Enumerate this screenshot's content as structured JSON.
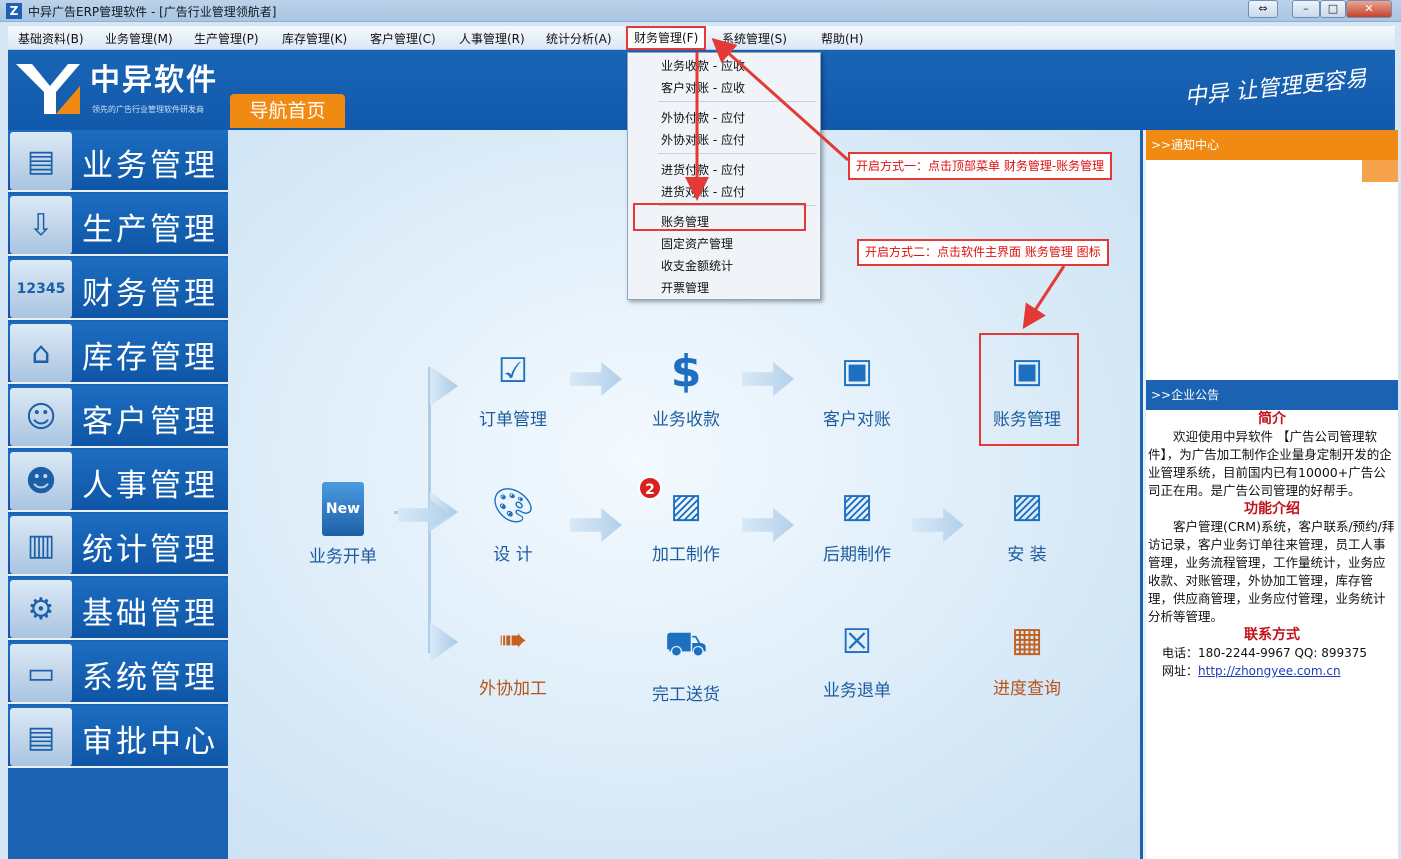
{
  "window": {
    "title": "中异广告ERP管理软件 - [广告行业管理领航者]",
    "controls": {
      "restore_alt": "⇔",
      "minimize": "–",
      "maximize": "□",
      "close": "✕"
    }
  },
  "menubar": [
    "基础资料(B)",
    "业务管理(M)",
    "生产管理(P)",
    "库存管理(K)",
    "客户管理(C)",
    "人事管理(R)",
    "统计分析(A)",
    "财务管理(F)",
    "系统管理(S)",
    "帮助(H)"
  ],
  "banner": {
    "brand": "中异软件",
    "tagline": "领先的广告行业管理软件研发商",
    "nav_tab": "导航首页",
    "slogan": "中异 让管理更容易"
  },
  "dropdown": {
    "items": [
      "业务收款 - 应收",
      "客户对账 - 应收",
      "外协付款 - 应付",
      "外协对账 - 应付",
      "进货付款 - 应付",
      "进货对账 - 应付",
      "账务管理",
      "固定资产管理",
      "收支金额统计",
      "开票管理"
    ]
  },
  "sidebar": [
    {
      "label": "业务管理",
      "icon": "document-icon"
    },
    {
      "label": "生产管理",
      "icon": "download-doc-icon"
    },
    {
      "label": "财务管理",
      "icon": "calculator-icon"
    },
    {
      "label": "库存管理",
      "icon": "warehouse-icon"
    },
    {
      "label": "客户管理",
      "icon": "person-icon"
    },
    {
      "label": "人事管理",
      "icon": "people-icon"
    },
    {
      "label": "统计管理",
      "icon": "chart-icon"
    },
    {
      "label": "基础管理",
      "icon": "gears-icon"
    },
    {
      "label": "系统管理",
      "icon": "monitor-icon"
    },
    {
      "label": "审批中心",
      "icon": "clipboard-icon"
    }
  ],
  "flow": {
    "start": {
      "label": "业务开单",
      "icon": "new-doc-icon",
      "glyph": "New"
    },
    "nodes": [
      {
        "label": "订单管理",
        "icon": "check-doc-icon"
      },
      {
        "label": "业务收款",
        "icon": "dollar-icon"
      },
      {
        "label": "客户对账",
        "icon": "ledger-icon"
      },
      {
        "label": "账务管理",
        "icon": "ledger-icon"
      },
      {
        "label": "设 计",
        "icon": "palette-icon"
      },
      {
        "label": "加工制作",
        "icon": "image-edit-icon"
      },
      {
        "label": "后期制作",
        "icon": "image-edit-icon"
      },
      {
        "label": "安 装",
        "icon": "image-edit-icon"
      },
      {
        "label": "外协加工",
        "icon": "outsource-icon"
      },
      {
        "label": "完工送货",
        "icon": "truck-icon"
      },
      {
        "label": "业务退单",
        "icon": "cancel-doc-icon"
      },
      {
        "label": "进度查询",
        "icon": "progress-icon"
      }
    ],
    "badge": "2"
  },
  "annotations": {
    "method1": "开启方式一：点击顶部菜单 财务管理-账务管理",
    "method2": "开启方式二：点击软件主界面 账务管理 图标"
  },
  "right_panel": {
    "notice_header": ">>通知中心",
    "announce_header": ">>企业公告",
    "intro_title": "简介",
    "intro_text": "欢迎使用中异软件 【广告公司管理软件】，为广告加工制作企业量身定制开发的企业管理系统，目前国内已有10000+广告公司正在用。是广告公司管理的好帮手。",
    "feature_title": "功能介绍",
    "feature_text": "客户管理(CRM)系统，客户联系/预约/拜访记录，客户业务订单往来管理，员工人事管理，业务流程管理，工作量统计，业务应收款、对账管理，外协加工管理，库存管理，供应商管理，业务应付管理，业务统计分析等管理。",
    "contact_title": "联系方式",
    "phone": "电话：180-2244-9967  QQ: 899375",
    "site_label": "网址：",
    "site_url": "http://zhongyee.com.cn"
  }
}
